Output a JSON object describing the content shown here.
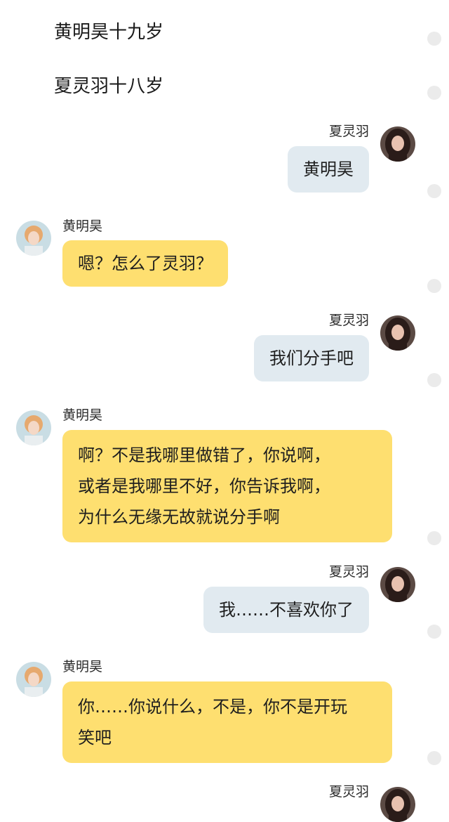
{
  "intro": {
    "line1": "黄明昊十九岁",
    "line2": "夏灵羽十八岁"
  },
  "participants": {
    "me": "夏灵羽",
    "him": "黄明昊"
  },
  "messages": [
    {
      "sender": "夏灵羽",
      "text": "黄明昊"
    },
    {
      "sender": "黄明昊",
      "text": "嗯？怎么了灵羽？"
    },
    {
      "sender": "夏灵羽",
      "text": "我们分手吧"
    },
    {
      "sender": "黄明昊",
      "lines": [
        "啊？不是我哪里做错了，你说啊，",
        "或者是我哪里不好，你告诉我啊，",
        "为什么无缘无故就说分手啊"
      ]
    },
    {
      "sender": "夏灵羽",
      "text": "我……不喜欢你了"
    },
    {
      "sender": "黄明昊",
      "lines": [
        "你……你说什么，不是，你不是开玩",
        "笑吧"
      ]
    },
    {
      "sender": "夏灵羽"
    }
  ],
  "colors": {
    "my_bubble": "#e1eaf0",
    "his_bubble": "#fedf70",
    "status_dot": "#ebebeb"
  },
  "icons": {
    "my_avatar": "girl-portrait-avatar",
    "his_avatar": "boy-portrait-avatar",
    "status_dot": "unread-dot-icon"
  }
}
